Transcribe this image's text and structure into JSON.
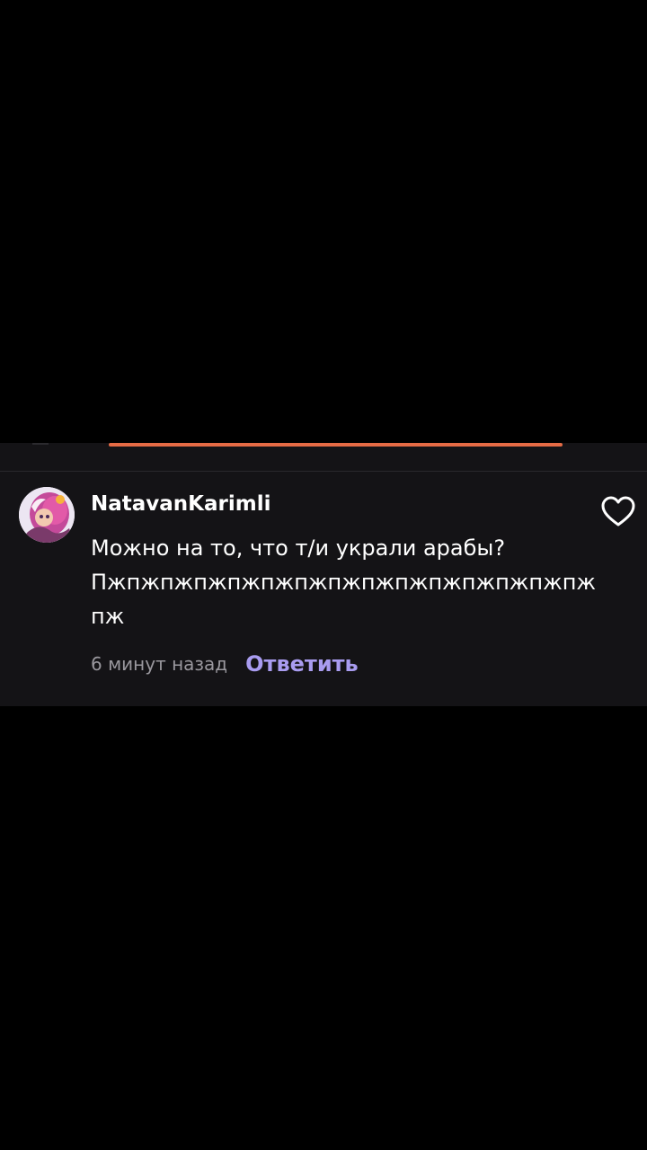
{
  "video": {
    "progress_fraction": 0.7,
    "progress_color": "#e56b45"
  },
  "comment": {
    "username": "NatavanKarimli",
    "text_lines": [
      "Можно на то, что т/и украли арабы?",
      "Пжпжпжпжпжпжпжпжпжпжпжпжпжпжпж",
      "пж"
    ],
    "time": "6 минут назад",
    "reply_label": "Ответить",
    "avatar_icon": "anime-character-avatar",
    "like_icon": "heart-outline-icon"
  },
  "colors": {
    "background": "#000000",
    "panel": "#141316",
    "accent": "#a99cf0",
    "muted": "#9a989e"
  }
}
